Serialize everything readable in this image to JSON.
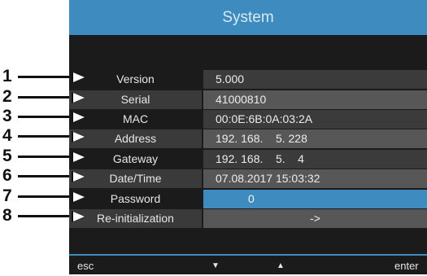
{
  "window": {
    "title": "System"
  },
  "rows": [
    {
      "num": "1",
      "label": "Version",
      "value": "5.000"
    },
    {
      "num": "2",
      "label": "Serial",
      "value": "41000810"
    },
    {
      "num": "3",
      "label": "MAC",
      "value": "00:0E:6B:0A:03:2A"
    },
    {
      "num": "4",
      "label": "Address",
      "value": "192. 168.    5. 228"
    },
    {
      "num": "5",
      "label": "Gateway",
      "value": "192. 168.    5.    4"
    },
    {
      "num": "6",
      "label": "Date/Time",
      "value": "07.08.2017 15:03:32"
    },
    {
      "num": "7",
      "label": "Password",
      "value": "0"
    },
    {
      "num": "8",
      "label": "Re-initialization",
      "value": "->"
    }
  ],
  "softkeys": {
    "esc": "esc",
    "down": "▼",
    "up": "▲",
    "enter": "enter"
  },
  "colors": {
    "accent": "#3e8bbf",
    "background": "#1b1b1b"
  }
}
